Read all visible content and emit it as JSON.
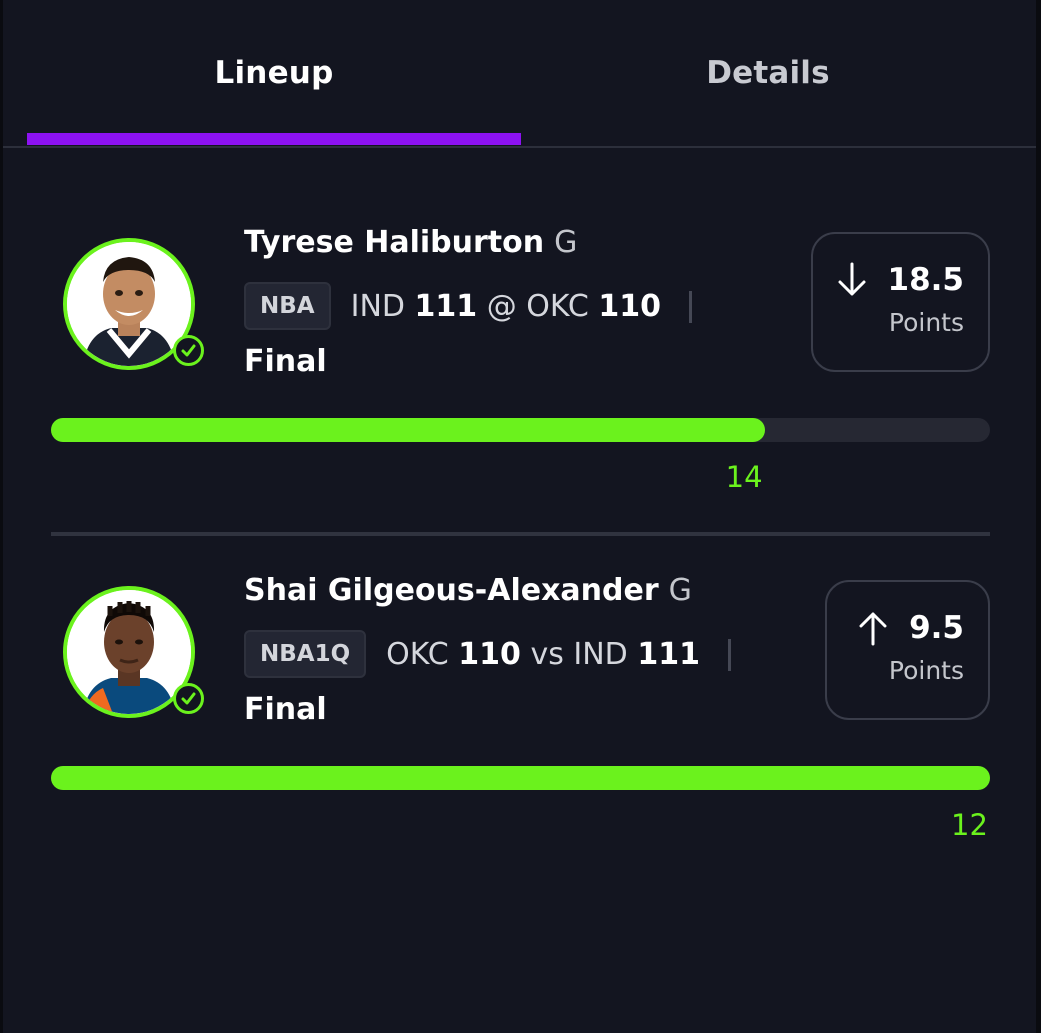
{
  "tabs": [
    {
      "label": "Lineup",
      "active": true
    },
    {
      "label": "Details",
      "active": false
    }
  ],
  "colors": {
    "accent": "#8d12f2",
    "success": "#6bf21d",
    "background": "#131520"
  },
  "icons": {
    "check": "check-circle-icon",
    "down": "arrow-down-icon",
    "up": "arrow-up-icon"
  },
  "picks": [
    {
      "player_name": "Tyrese Haliburton",
      "position": "G",
      "league": "NBA",
      "away_team": "IND",
      "away_score": "111",
      "separator": "@",
      "home_team": "OKC",
      "home_score": "110",
      "status": "Final",
      "direction": "down",
      "line": "18.5",
      "stat": "Points",
      "actual": "14",
      "progress": 0.76
    },
    {
      "player_name": "Shai Gilgeous-Alexander",
      "position": "G",
      "league": "NBA1Q",
      "away_team": "OKC",
      "away_score": "110",
      "separator": "vs",
      "home_team": "IND",
      "home_score": "111",
      "status": "Final",
      "direction": "up",
      "line": "9.5",
      "stat": "Points",
      "actual": "12",
      "progress": 1.0
    }
  ]
}
